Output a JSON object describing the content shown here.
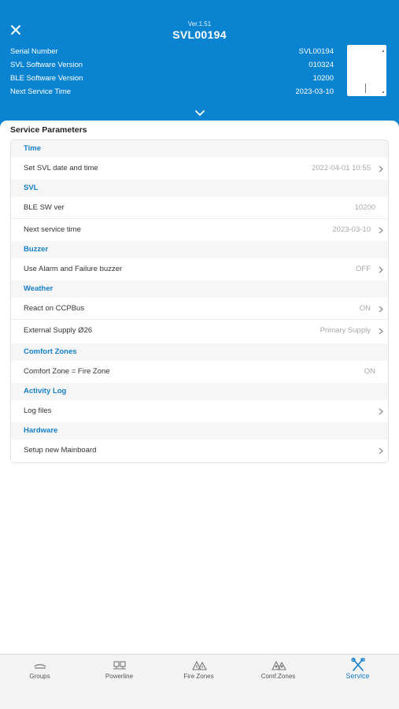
{
  "colors": {
    "header_bg": "#0a84d0",
    "accent": "#1480c9",
    "muted_value": "#a8a8a8"
  },
  "header": {
    "close_icon": "close-icon",
    "version": "Ver.1.51",
    "title": "SVL00194",
    "info": [
      {
        "label": "Serial Number",
        "value": "SVL00194"
      },
      {
        "label": "SVL Software Version",
        "value": "010324"
      },
      {
        "label": "BLE Software Version",
        "value": "10200"
      },
      {
        "label": "Next Service Time",
        "value": "2023-03-10"
      }
    ],
    "expand_icon": "chevron-down-icon"
  },
  "main": {
    "title": "Service Parameters",
    "sections": [
      {
        "title": "Time",
        "rows": [
          {
            "label": "Set SVL date and time",
            "value": "2022-04-01 10:55",
            "chevron": true
          }
        ]
      },
      {
        "title": "SVL",
        "rows": [
          {
            "label": "BLE SW ver",
            "value": "10200",
            "chevron": false
          },
          {
            "label": "Next service time",
            "value": "2023-03-10",
            "chevron": true
          }
        ]
      },
      {
        "title": "Buzzer",
        "rows": [
          {
            "label": "Use Alarm and Failure buzzer",
            "value": "OFF",
            "chevron": true
          }
        ]
      },
      {
        "title": "Weather",
        "rows": [
          {
            "label": "React on CCPBus",
            "value": "ON",
            "chevron": true
          },
          {
            "label": "External Supply Ø26",
            "value": "Primary Supply",
            "chevron": true
          }
        ]
      },
      {
        "title": "Comfort Zones",
        "rows": [
          {
            "label": "Comfort Zone = Fire Zone",
            "value": "ON",
            "chevron": false
          }
        ]
      },
      {
        "title": "Activity Log",
        "rows": [
          {
            "label": "Log files",
            "value": "",
            "chevron": true
          }
        ]
      },
      {
        "title": "Hardware",
        "rows": [
          {
            "label": "Setup new Mainboard",
            "value": "",
            "chevron": true
          }
        ]
      }
    ]
  },
  "tabs": [
    {
      "label": "Groups",
      "icon": "groups-icon",
      "active": false
    },
    {
      "label": "Powerline",
      "icon": "powerline-icon",
      "active": false
    },
    {
      "label": "Fire Zones",
      "icon": "fire-zones-icon",
      "active": false
    },
    {
      "label": "Comf.Zones",
      "icon": "comfort-zones-icon",
      "active": false
    },
    {
      "label": "Service",
      "icon": "service-tools-icon",
      "active": true
    }
  ]
}
